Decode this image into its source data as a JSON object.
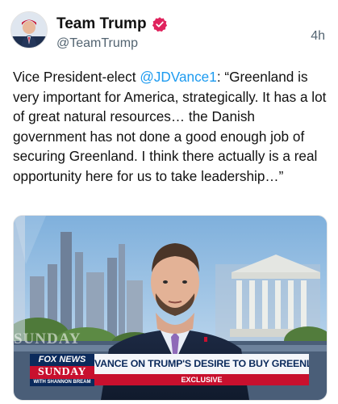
{
  "author": {
    "name": "Team Trump",
    "handle": "@TeamTrump",
    "time": "4h",
    "avatar_icon": "avatar-photo-icon",
    "verified_icon": "verified-badge-icon",
    "verified_color": "#e0245e"
  },
  "tweet": {
    "text_before": "Vice President-elect ",
    "mention": "@JDVance1",
    "text_after": ": “Greenland is very important for America, strategically. It has a lot of great natural resources… the Danish government has not done a good enough job of securing Greenland. I think there actually is a real opportunity here for us to take leadership…”",
    "mention_color": "#1d9bf0"
  },
  "media": {
    "watermark": "SUNDAY",
    "logo_top": "FOX NEWS",
    "logo_mid": "SUNDAY",
    "logo_bottom": "WITH SHANNON BREAM",
    "headline": "VANCE ON TRUMP'S DESIRE TO BUY GREENLAND",
    "tag": "EXCLUSIVE",
    "colors": {
      "navy": "#0b2a5c",
      "red": "#c8102e"
    }
  }
}
